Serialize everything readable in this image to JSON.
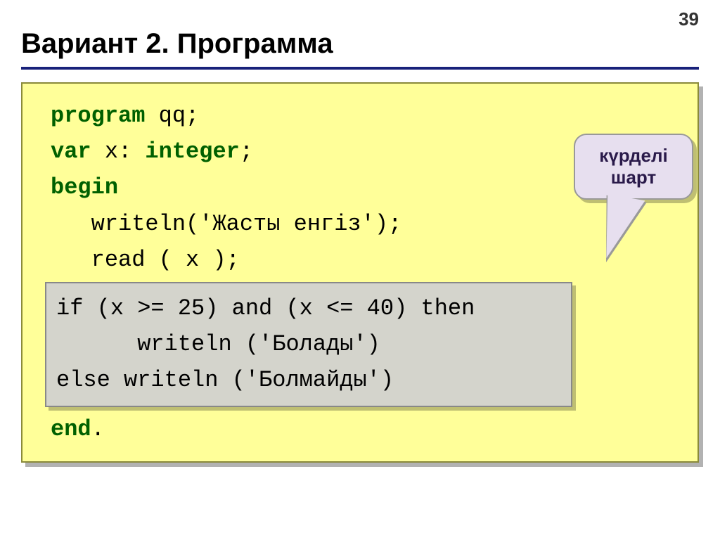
{
  "page_number": "39",
  "title": "Вариант 2. Программа",
  "code": {
    "line1_kw": "program",
    "line1_rest": " qq;",
    "line2_kw": "var",
    "line2_name": " x: ",
    "line2_type": "integer",
    "line2_end": ";",
    "line3_kw": "begin",
    "line4": "   writeln('Жасты енгіз');",
    "line5": "   read ( x );",
    "hl_line1": "if (x >= 25) and (x <= 40) then",
    "hl_line2": "      writeln ('Болады')",
    "hl_line3": "else writeln ('Болмайды')",
    "line9_kw": "end",
    "line9_rest": "."
  },
  "callout": {
    "line1": "күрделі",
    "line2": "шарт"
  }
}
